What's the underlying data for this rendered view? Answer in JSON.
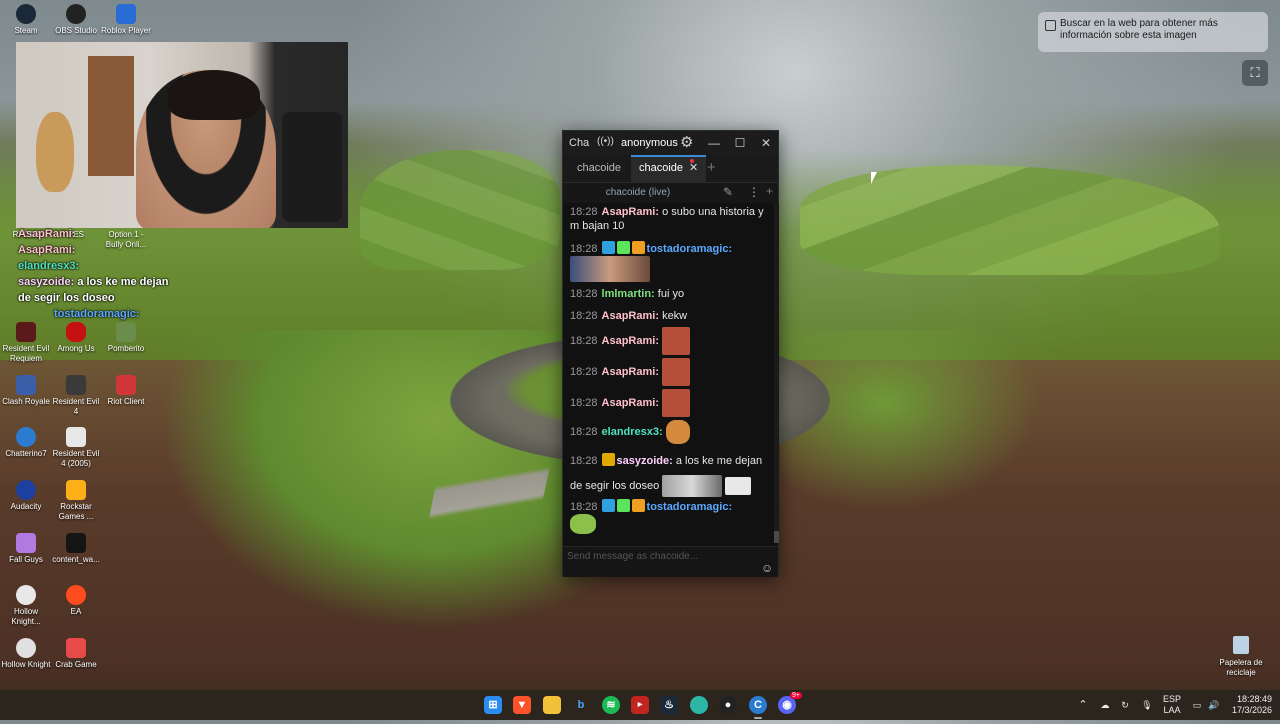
{
  "desktop_icons": [
    {
      "label": "Steam"
    },
    {
      "label": "OBS Studio"
    },
    {
      "label": "Roblox Player"
    },
    {
      "label": "RPCS3"
    },
    {
      "label": "PES"
    },
    {
      "label": "Option 1 - Bully Onli..."
    },
    {
      "label": "Resident Evil Requiem"
    },
    {
      "label": "Among Us"
    },
    {
      "label": "Pomberito"
    },
    {
      "label": "Clash Royale"
    },
    {
      "label": "Resident Evil 4"
    },
    {
      "label": "Riot Client"
    },
    {
      "label": "Chatterino7"
    },
    {
      "label": "Resident Evil 4 (2005)"
    },
    {
      "label": "Audacity"
    },
    {
      "label": "Rockstar Games ..."
    },
    {
      "label": "Fall Guys"
    },
    {
      "label": "content_wa..."
    },
    {
      "label": "Hollow Knight..."
    },
    {
      "label": "EA"
    },
    {
      "label": "Hollow Knight"
    },
    {
      "label": "Crab Game"
    }
  ],
  "recycle_bin": {
    "label": "Papelera de reciclaje"
  },
  "stream_overlay_chat": [
    {
      "user": "AsapRami:",
      "text": ""
    },
    {
      "user": "AsapRami:",
      "text": ""
    },
    {
      "user": "elandresx3:",
      "text": ""
    },
    {
      "user": "sasyzoide:",
      "text": "a los ke me dejan"
    },
    {
      "user": "",
      "text": "de segir los doseo"
    },
    {
      "user": "tostadoramagic:",
      "text": ""
    }
  ],
  "visual_search": {
    "tip": "Buscar en la web para obtener más información sobre esta imagen"
  },
  "chat_window": {
    "title": "Cha",
    "account": "anonymous",
    "tabs": [
      {
        "label": "chacoide",
        "active": false
      },
      {
        "label": "chacoide",
        "active": true
      }
    ],
    "channel_header": "chacoide (live)",
    "input_placeholder": "Send message as chacoide...",
    "messages": [
      {
        "time": "18:28",
        "user": "AsapRami:",
        "user_color": "#ffc0cb",
        "text": "o subo una historia y m bajan 10"
      },
      {
        "time": "18:28",
        "user": "tostadoramagic:",
        "user_color": "#5aa8ff",
        "text": ""
      },
      {
        "time": "18:28",
        "user": "lmlmartin:",
        "user_color": "#7fe07f",
        "text": "fui yo"
      },
      {
        "time": "18:28",
        "user": "AsapRami:",
        "user_color": "#ffc0cb",
        "text": "kekw"
      },
      {
        "time": "18:28",
        "user": "AsapRami:",
        "user_color": "#ffc0cb",
        "text": ""
      },
      {
        "time": "18:28",
        "user": "AsapRami:",
        "user_color": "#ffc0cb",
        "text": ""
      },
      {
        "time": "18:28",
        "user": "AsapRami:",
        "user_color": "#ffc0cb",
        "text": ""
      },
      {
        "time": "18:28",
        "user": "elandresx3:",
        "user_color": "#4fe0c0",
        "text": ""
      },
      {
        "time": "18:28",
        "user": "sasyzoide:",
        "user_color": "#ffd0ff",
        "text": "a los ke me dejan"
      },
      {
        "time": "",
        "user": "",
        "user_color": "#e6e6e6",
        "text": "de segir los doseo"
      },
      {
        "time": "18:28",
        "user": "tostadoramagic:",
        "user_color": "#5aa8ff",
        "text": ""
      }
    ]
  },
  "taskbar": {
    "apps": [
      "windows-start",
      "brave",
      "file-explorer",
      "bing",
      "spotify",
      "videos",
      "steam",
      "edge",
      "obs",
      "chatterino",
      "discord"
    ],
    "discord_badge": "9+",
    "language": "ESP",
    "layout": "LAA",
    "time": "18:28:49",
    "date": "17/3/2026"
  }
}
